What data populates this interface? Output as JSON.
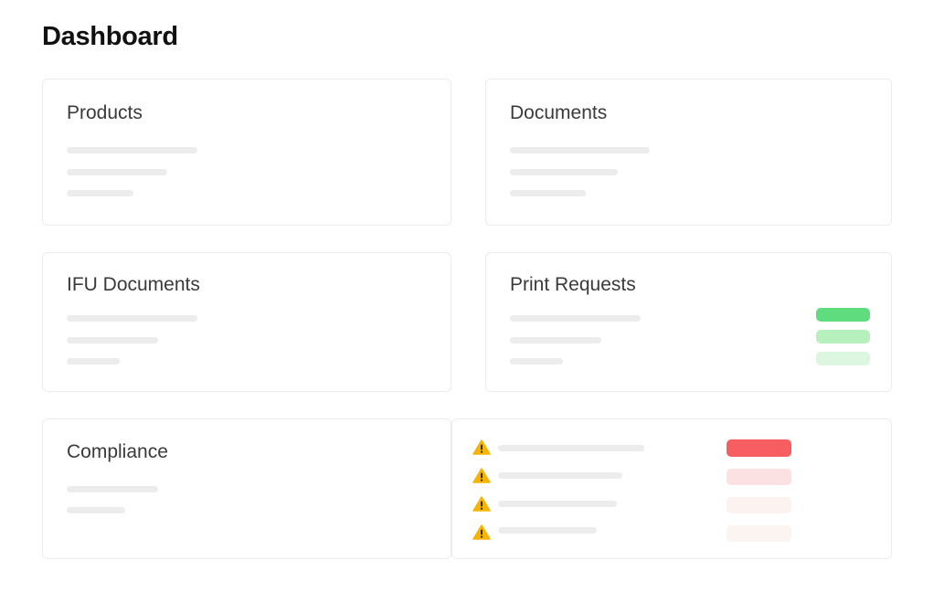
{
  "page": {
    "title": "Dashboard"
  },
  "cards": {
    "products": {
      "title": "Products"
    },
    "documents": {
      "title": "Documents"
    },
    "ifu": {
      "title": "IFU Documents"
    },
    "print_requests": {
      "title": "Print Requests",
      "status_colors": [
        "#5fdc7e",
        "#b6f0bd",
        "#ddf6df"
      ]
    },
    "compliance": {
      "title": "Compliance",
      "alert_icon": "warning-icon",
      "alert_colors": [
        "#f65e62",
        "#fbe1e2",
        "#fcf2ef",
        "#fcf4f1"
      ]
    }
  }
}
